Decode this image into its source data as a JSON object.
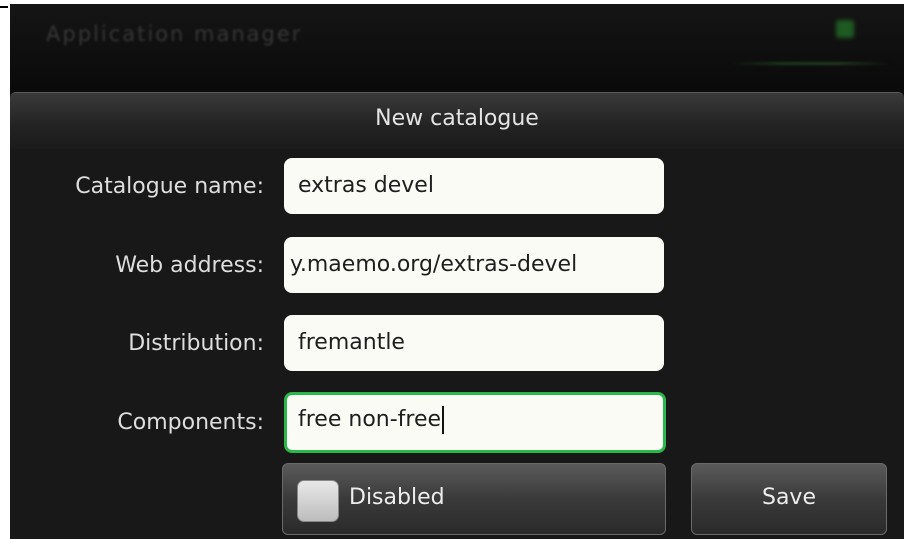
{
  "background": {
    "title": "Application manager"
  },
  "dialog": {
    "title": "New catalogue",
    "fields": [
      {
        "label": "Catalogue name:",
        "value": "extras devel"
      },
      {
        "label": "Web address:",
        "value": "y.maemo.org/extras-devel"
      },
      {
        "label": "Distribution:",
        "value": "fremantle"
      },
      {
        "label": "Components:",
        "value": "free non-free"
      }
    ],
    "disabled_checkbox": {
      "label": "Disabled",
      "checked": false
    },
    "save_label": "Save"
  },
  "colors": {
    "focus_border": "#2bb84a",
    "background": "#0c0c0c"
  }
}
